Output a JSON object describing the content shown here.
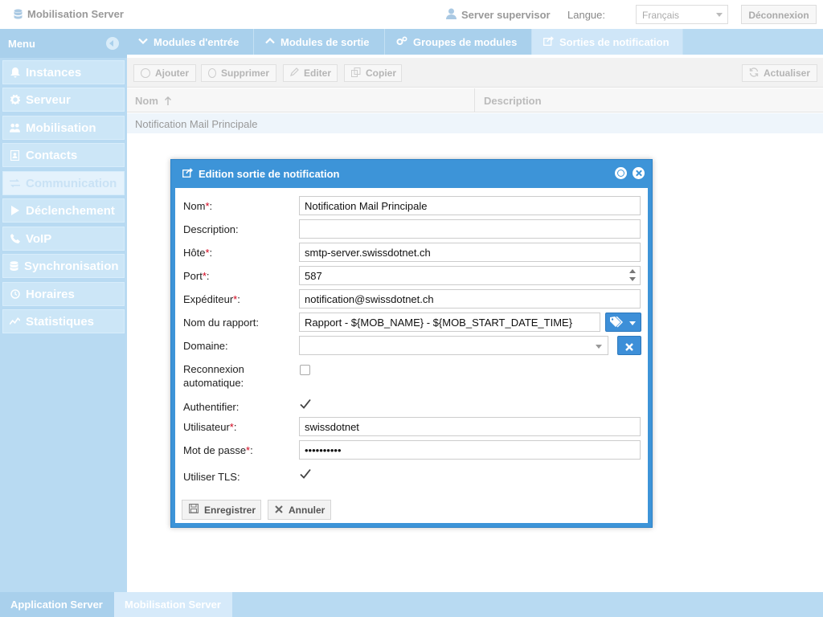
{
  "app": {
    "title": "Mobilisation Server"
  },
  "header": {
    "user": "Server supervisor",
    "language_label": "Langue:",
    "language_value": "Français",
    "logout_label": "Déconnexion"
  },
  "sidebar": {
    "title": "Menu",
    "items": [
      {
        "label": "Instances",
        "icon": "bell-icon"
      },
      {
        "label": "Serveur",
        "icon": "gear-icon"
      },
      {
        "label": "Mobilisation",
        "icon": "users-icon"
      },
      {
        "label": "Contacts",
        "icon": "address-book-icon"
      },
      {
        "label": "Communication",
        "icon": "exchange-icon",
        "active": true
      },
      {
        "label": "Déclenchement",
        "icon": "play-icon"
      },
      {
        "label": "VoIP",
        "icon": "phone-icon"
      },
      {
        "label": "Synchronisation",
        "icon": "database-icon"
      },
      {
        "label": "Horaires",
        "icon": "clock-icon"
      },
      {
        "label": "Statistiques",
        "icon": "chart-line-icon"
      }
    ]
  },
  "tabs": [
    {
      "label": "Modules d'entrée",
      "icon": "chevron-down-icon"
    },
    {
      "label": "Modules de sortie",
      "icon": "chevron-up-icon"
    },
    {
      "label": "Groupes de modules",
      "icon": "cogs-icon"
    },
    {
      "label": "Sorties de notification",
      "icon": "share-icon",
      "active": true
    }
  ],
  "toolbar": {
    "add": "Ajouter",
    "delete": "Supprimer",
    "edit": "Editer",
    "copy": "Copier",
    "refresh": "Actualiser"
  },
  "grid": {
    "columns": [
      "Nom",
      "Description"
    ],
    "rows": [
      {
        "name": "Notification Mail Principale",
        "description": ""
      }
    ]
  },
  "dialog": {
    "title": "Edition sortie de notification",
    "fields": {
      "name_label": "Nom",
      "name_value": "Notification Mail Principale",
      "description_label": "Description:",
      "description_value": "",
      "host_label": "Hôte",
      "host_value": "smtp-server.swissdotnet.ch",
      "port_label": "Port",
      "port_value": "587",
      "sender_label": "Expéditeur",
      "sender_value": "notification@swissdotnet.ch",
      "report_label": "Nom du rapport:",
      "report_value": "Rapport - ${MOB_NAME} - ${MOB_START_DATE_TIME}",
      "domain_label": "Domaine:",
      "domain_value": "",
      "reconnect_label": "Reconnexion automatique:",
      "reconnect_checked": false,
      "auth_label": "Authentifier:",
      "auth_checked": true,
      "user_label": "Utilisateur",
      "user_value": "swissdotnet",
      "password_label": "Mot de passe",
      "password_value": "••••••••••",
      "tls_label": "Utiliser TLS:",
      "tls_checked": true
    },
    "required_mark": "*",
    "colon": ":",
    "save_label": "Enregistrer",
    "cancel_label": "Annuler"
  },
  "footer": {
    "tabs": [
      "Application Server",
      "Mobilisation Server"
    ]
  },
  "colors": {
    "accent": "#3d94d8",
    "sidebar": "#b8daf2",
    "required": "#d0021b"
  }
}
